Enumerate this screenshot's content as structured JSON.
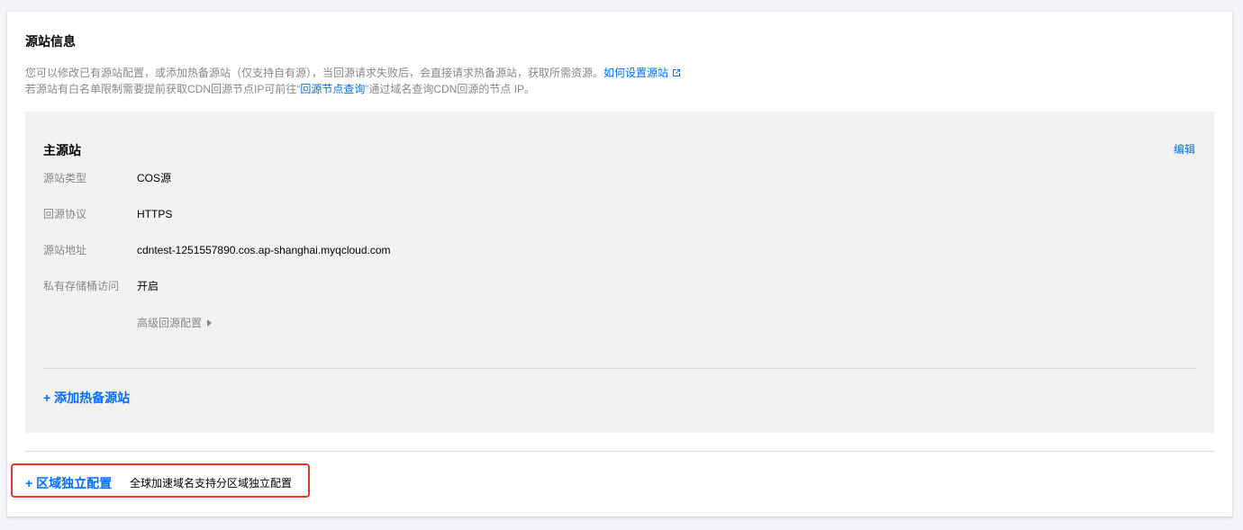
{
  "section": {
    "title": "源站信息",
    "desc_line1_prefix": "您可以修改已有源站配置，或添加热备源站（仅支持自有源），当回源请求失败后，会直接请求热备源站，获取所需资源。",
    "desc_line1_link": "如何设置源站",
    "desc_line2_prefix": "若源站有白名单限制需要提前获取CDN回源节点IP可前往“",
    "desc_line2_link": "回源节点查询",
    "desc_line2_suffix": "”通过域名查询CDN回源的节点 IP。"
  },
  "primary": {
    "title": "主源站",
    "edit_label": "编辑",
    "fields": [
      {
        "label": "源站类型",
        "value": "COS源"
      },
      {
        "label": "回源协议",
        "value": "HTTPS"
      },
      {
        "label": "源站地址",
        "value": "cdntest-1251557890.cos.ap-shanghai.myqcloud.com"
      },
      {
        "label": "私有存储桶访问",
        "value": "开启"
      }
    ],
    "advanced_label": "高级回源配置",
    "add_backup_label": "+ 添加热备源站"
  },
  "region": {
    "link_label": "+ 区域独立配置",
    "desc": "全球加速域名支持分区域独立配置"
  },
  "colors": {
    "accent": "#006eff",
    "highlight_border": "#e8342b",
    "muted_text": "#888888",
    "panel_bg": "#f2f2f2"
  }
}
